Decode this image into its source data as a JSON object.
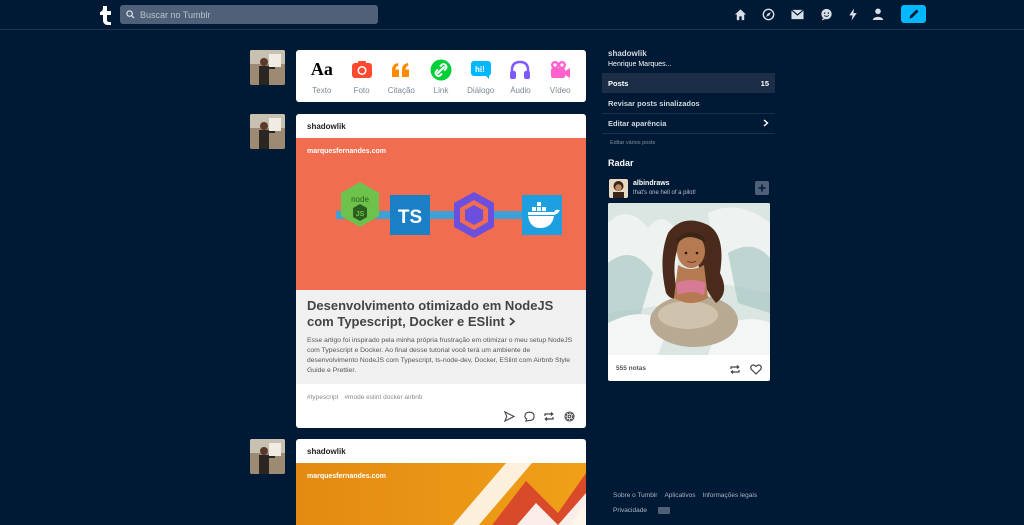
{
  "header": {
    "search_placeholder": "Buscar no Tumblr"
  },
  "post_types": [
    {
      "label": "Texto",
      "icon": "text-icon",
      "color": "#000000"
    },
    {
      "label": "Foto",
      "icon": "camera-icon",
      "color": "#ff4930"
    },
    {
      "label": "Citação",
      "icon": "quote-icon",
      "color": "#ff8a00"
    },
    {
      "label": "Link",
      "icon": "link-icon",
      "color": "#00cf35"
    },
    {
      "label": "Diálogo",
      "icon": "chat-icon",
      "color": "#00b8ff"
    },
    {
      "label": "Áudio",
      "icon": "headphones-icon",
      "color": "#7c5cff"
    },
    {
      "label": "Vídeo",
      "icon": "video-camera-icon",
      "color": "#ff62ce"
    }
  ],
  "posts": [
    {
      "author": "shadowlik",
      "domain": "marquesfernandes.com",
      "title": "Desenvolvimento otimizado em NodeJS com Typescript, Docker e ESlint",
      "description": "Esse artigo foi inspirado pela minha própria frustração em otimizar o meu setup NodeJS com Typescript e Docker. Ao final desse tutorial você terá um ambiente de desenvolvimento NodeJS com Typescript, ts-node-dev, Docker, ESlint com Airbnb Style Guide e Prettier.",
      "tags": [
        "#typescript",
        "#mode eslint docker airbnb"
      ],
      "banner_logos": {
        "node": "node",
        "ts": "TS"
      }
    },
    {
      "author": "shadowlik",
      "domain": "marquesfernandes.com"
    }
  ],
  "sidebar": {
    "username": "shadowlik",
    "fullname": "Henrique Marques...",
    "posts_label": "Posts",
    "posts_count": "15",
    "review_label": "Revisar posts sinalizados",
    "appearance_label": "Editar aparência",
    "mass_edit_label": "Editar vários posts"
  },
  "radar": {
    "title": "Radar",
    "user": "albindraws",
    "caption": "that's one hell of a pilot!",
    "notes": "555 notas"
  },
  "footer": {
    "links": [
      "Sobre o Tumblr",
      "Aplicativos",
      "Informações legais"
    ],
    "privacy": "Privacidade"
  }
}
